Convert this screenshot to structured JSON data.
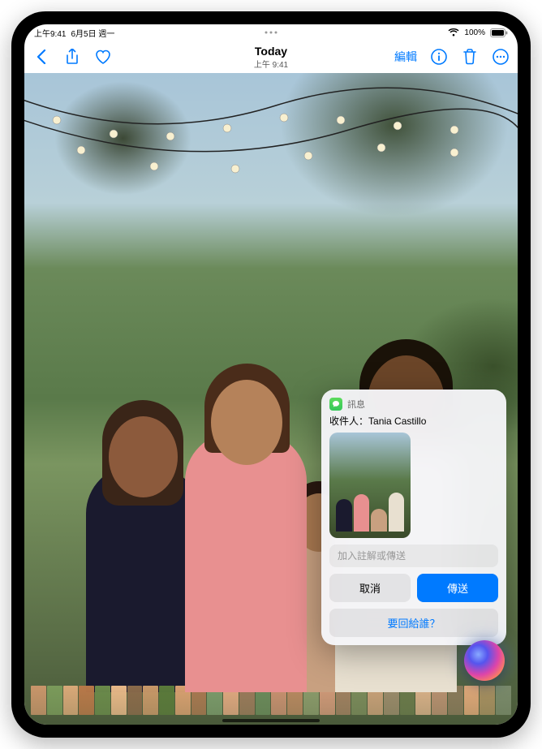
{
  "status": {
    "time": "上午9:41",
    "date": "6月5日 週一",
    "battery": "100%"
  },
  "nav": {
    "title": "Today",
    "subtitle": "上午 9:41",
    "edit_label": "編輯"
  },
  "siri_card": {
    "app_label": "訊息",
    "recipient_prefix": "收件人：",
    "recipient_name": "Tania Castillo",
    "input_placeholder": "加入註解或傳送",
    "cancel_label": "取消",
    "send_label": "傳送",
    "reply_to_label": "要回給誰？"
  },
  "colors": {
    "accent": "#007aff",
    "send_bg": "#007aff"
  },
  "filmstrip_colors": [
    "#c8956a",
    "#7a9a5a",
    "#d8a878",
    "#b87848",
    "#6a8a4a",
    "#e8b888",
    "#8a6a4a",
    "#c89868",
    "#5a7a3a",
    "#d8a070",
    "#a87850",
    "#7a9a6a",
    "#e0a880",
    "#9a7a5a",
    "#6a8a5a",
    "#c89070",
    "#b88860",
    "#8a9a6a",
    "#d09878",
    "#a08060",
    "#7a8a5a",
    "#c8a078",
    "#9a8a6a",
    "#6a7a4a",
    "#d8b088",
    "#b89070",
    "#8a7a5a",
    "#e0a878",
    "#a89060",
    "#7a8a6a"
  ]
}
